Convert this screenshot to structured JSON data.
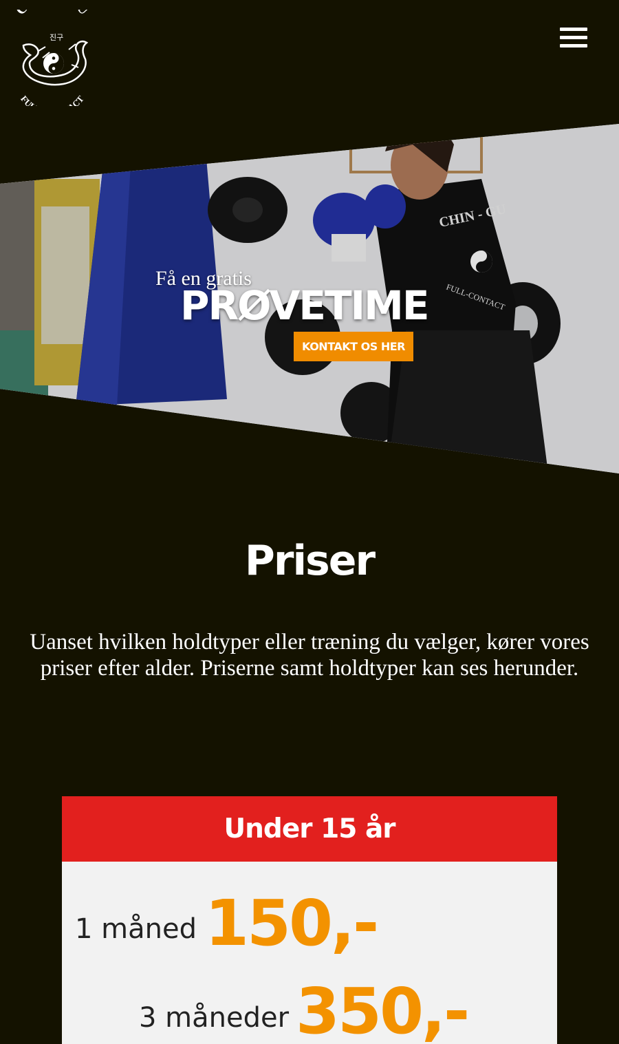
{
  "logo": {
    "top_text": "CHIN - GU",
    "bottom_text": "FULL - CONTACT",
    "korean": "진구"
  },
  "menu": {
    "icon": "hamburger-icon"
  },
  "hero": {
    "small_text": "Få en gratis",
    "big_text": "PRØVETIME",
    "cta_label": "KONTAKT OS HER"
  },
  "prices": {
    "title": "Priser",
    "intro": "Uanset hvilken holdtyper eller træning du vælger, kører vores priser efter alder. Priserne samt holdtyper kan ses herunder.",
    "card": {
      "header": "Under 15 år",
      "rows": [
        {
          "period": "1 måned",
          "amount": "150,-"
        },
        {
          "period": "3 måneder",
          "amount": "350,-"
        }
      ]
    }
  },
  "colors": {
    "background": "#141200",
    "accent_orange": "#f39200",
    "card_red": "#e2201e",
    "card_bg": "#f2f2f2"
  }
}
